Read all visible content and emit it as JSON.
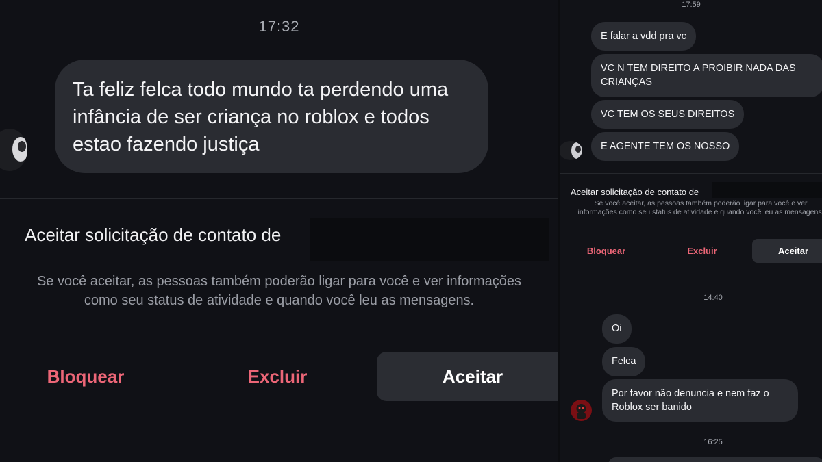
{
  "left_screenshot": {
    "time": "17:32",
    "message": "Ta feliz felca todo mundo ta perdendo uma infância de ser criança no roblox e todos estao fazendo justiça",
    "request_title": "Aceitar solicitação de contato de",
    "request_description": "Se você aceitar, as pessoas também poderão ligar para você e ver informações como seu status de atividade e quando você leu as mensagens.",
    "block_label": "Bloquear",
    "delete_label": "Excluir",
    "accept_label": "Aceitar"
  },
  "right_screenshot": {
    "time_top": "17:59",
    "messages_group1": [
      "E falar a vdd pra vc",
      "VC N TEM DIREITO A PROIBIR NADA DAS CRIANÇAS",
      "VC TEM OS SEUS DIREITOS",
      "E AGENTE TEM OS NOSSO"
    ],
    "request_title": "Aceitar solicitação de contato de",
    "request_description": "Se você aceitar, as pessoas também poderão ligar para você e ver informações como seu status de atividade e quando você leu as mensagens.",
    "block_label": "Bloquear",
    "delete_label": "Excluir",
    "accept_label": "Aceitar",
    "time_middle": "14:40",
    "messages_group2": [
      "Oi",
      "Felca",
      "Por favor não denuncia e nem faz o Roblox ser banido"
    ],
    "time_bottom": "16:25"
  },
  "colors": {
    "background": "#101116",
    "bubble": "#2a2c32",
    "destructive": "#ec6677",
    "accept_button": "#2b2d33"
  }
}
